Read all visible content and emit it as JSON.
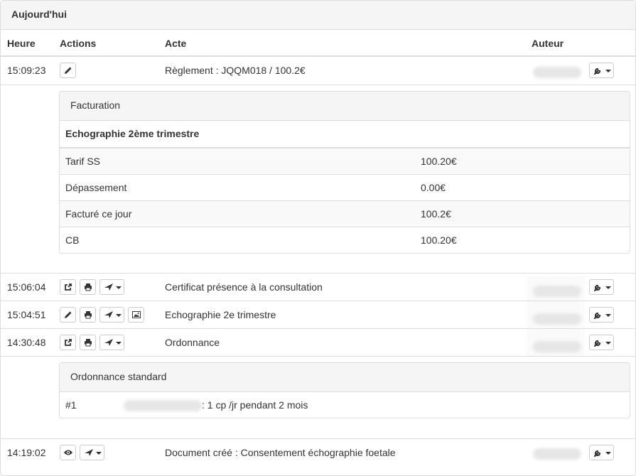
{
  "panel": {
    "title": "Aujourd'hui"
  },
  "table": {
    "headers": {
      "time": "Heure",
      "actions": "Actions",
      "act": "Acte",
      "author": "Auteur"
    }
  },
  "rows": [
    {
      "time": "15:09:23",
      "act": "Règlement : JQQM018 / 100.2€"
    },
    {
      "time": "15:06:04",
      "act": "Certificat présence à la consultation"
    },
    {
      "time": "15:04:51",
      "act": "Echographie 2e trimestre"
    },
    {
      "time": "14:30:48",
      "act": "Ordonnance"
    },
    {
      "time": "14:19:02",
      "act": "Document créé : Consentement échographie foetale"
    }
  ],
  "billing": {
    "title": "Facturation",
    "subtitle": "Echographie 2ème trimestre",
    "lines": [
      {
        "label": "Tarif SS",
        "value": "100.20€"
      },
      {
        "label": "Dépassement",
        "value": "0.00€"
      },
      {
        "label": "Facturé ce jour",
        "value": "100.2€"
      },
      {
        "label": "CB",
        "value": "100.20€"
      }
    ]
  },
  "prescription": {
    "title": "Ordonnance standard",
    "line_number": "#1",
    "dosage": ": 1 cp /jr pendant 2 mois"
  },
  "icons": {
    "edit": "pencil-icon",
    "share": "share-icon",
    "print": "print-icon",
    "send": "send-icon",
    "image": "image-icon",
    "view": "eye-icon",
    "tools": "wrench-icon"
  }
}
